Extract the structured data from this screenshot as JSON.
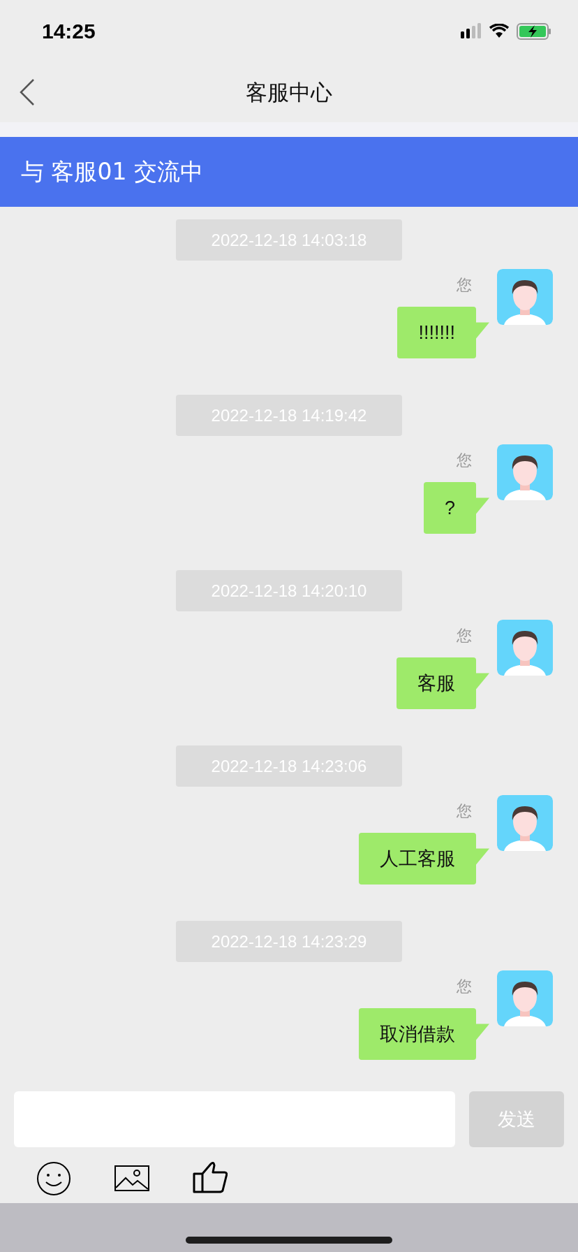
{
  "status_bar": {
    "time": "14:25"
  },
  "nav": {
    "title": "客服中心"
  },
  "banner": {
    "text": "与 客服01 交流中"
  },
  "messages": [
    {
      "timestamp": "2022-12-18 14:03:18",
      "sender": "您",
      "text": "!!!!!!!"
    },
    {
      "timestamp": "2022-12-18 14:19:42",
      "sender": "您",
      "text": "?"
    },
    {
      "timestamp": "2022-12-18 14:20:10",
      "sender": "您",
      "text": "客服"
    },
    {
      "timestamp": "2022-12-18 14:23:06",
      "sender": "您",
      "text": "人工客服"
    },
    {
      "timestamp": "2022-12-18 14:23:29",
      "sender": "您",
      "text": "取消借款"
    }
  ],
  "composer": {
    "send_button": {
      "label": "发送",
      "disabled": true
    }
  }
}
